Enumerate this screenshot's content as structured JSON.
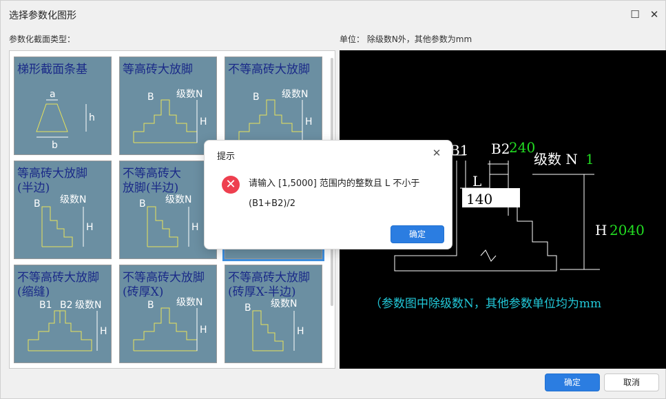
{
  "window": {
    "title": "选择参数化图形",
    "maximize_glyph": "☐",
    "close_glyph": "✕"
  },
  "gallery": {
    "label": "参数化截面类型：",
    "tiles": [
      {
        "line1": "梯形截面条基",
        "line2": "",
        "kind": "trapezoid",
        "dim_a": "a",
        "dim_b": "b",
        "dim_h": "h"
      },
      {
        "line1": "等高砖大放脚",
        "line2": "",
        "kind": "stepped",
        "dim_b": "B",
        "dim_n": "级数N",
        "dim_h": "H"
      },
      {
        "line1": "不等高砖大放脚",
        "line2": "",
        "kind": "stepped",
        "dim_b": "B",
        "dim_n": "级数N",
        "dim_h": "H"
      },
      {
        "line1": "等高砖大放脚",
        "line2": "(半边)",
        "kind": "half",
        "dim_b": "B",
        "dim_n": "级数N",
        "dim_h": "H"
      },
      {
        "line1": "不等高砖大",
        "line2": "放脚(半边)",
        "kind": "half",
        "dim_b": "B",
        "dim_n": "级数N",
        "dim_h": "H"
      },
      {
        "line1": "",
        "line2": "",
        "kind": "hidden",
        "dim_b": "",
        "dim_n": "",
        "dim_h": ""
      },
      {
        "line1": "不等高砖大放脚",
        "line2": "(缩缝)",
        "kind": "gap",
        "dim_b": "B1",
        "dim_b2": "B2",
        "dim_n": "级数N",
        "dim_h": "H"
      },
      {
        "line1": "不等高砖大放脚",
        "line2": "(砖厚X)",
        "kind": "stepped",
        "dim_b": "B",
        "dim_n": "级数N",
        "dim_h": "H"
      },
      {
        "line1": "不等高砖大放脚",
        "line2": "(砖厚X-半边)",
        "kind": "half",
        "dim_b": "B",
        "dim_n": "级数N",
        "dim_h": "H"
      }
    ]
  },
  "preview": {
    "unit_label": "单位：  除级数N外，其他参数为mm",
    "b1_label": "B1",
    "b2_label": "B2",
    "b2_value": "240",
    "n_label": "级数 N",
    "n_value": "1",
    "l_label": "L",
    "l_input_value": "140",
    "h_label": "H",
    "h_value": "2040",
    "note": "（参数图中除级数N，其他参数单位均为mm"
  },
  "modal": {
    "title": "提示",
    "close_glyph": "✕",
    "error_glyph": "✕",
    "message": "请输入 [1,5000] 范围内的整数且 L 不小于 (B1+B2)/2",
    "ok_label": "确定"
  },
  "footer": {
    "ok_label": "确定",
    "cancel_label": "取消"
  },
  "colors": {
    "tile_bg": "#6b8fa2",
    "tile_text": "#1a2a88",
    "sketch": "#e8e35a",
    "primary": "#2b7de1",
    "error": "#ee3f4f",
    "cad_green": "#22dd22",
    "cad_cyan": "#22c8d8"
  }
}
